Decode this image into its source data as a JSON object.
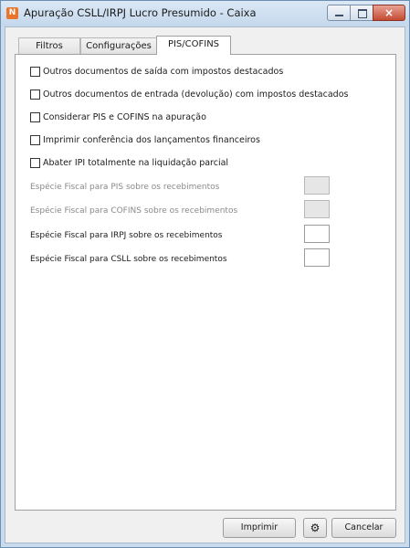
{
  "window": {
    "title": "Apuração CSLL/IRPJ Lucro Presumido - Caixa",
    "app_icon_glyph": "N",
    "close_glyph": "×"
  },
  "tabs": [
    {
      "label": "Filtros"
    },
    {
      "label": "Configurações"
    },
    {
      "label": "PIS/COFINS",
      "active": true
    }
  ],
  "checkboxes": [
    {
      "label": "Outros documentos de saída com impostos destacados",
      "checked": false
    },
    {
      "label": "Outros documentos de entrada (devolução) com impostos destacados",
      "checked": false
    },
    {
      "label": "Considerar PIS e COFINS na apuração",
      "checked": false
    },
    {
      "label": "Imprimir conferência dos lançamentos financeiros",
      "checked": false
    },
    {
      "label": "Abater IPI totalmente na liquidação parcial",
      "checked": false
    }
  ],
  "fields": [
    {
      "label": "Espécie Fiscal para PIS sobre os recebimentos",
      "value": "",
      "disabled": true
    },
    {
      "label": "Espécie Fiscal para COFINS sobre os recebimentos",
      "value": "",
      "disabled": true
    },
    {
      "label": "Espécie Fiscal para IRPJ sobre os recebimentos",
      "value": "",
      "disabled": false
    },
    {
      "label": "Espécie Fiscal para CSLL sobre os recebimentos",
      "value": "",
      "disabled": false
    }
  ],
  "buttons": {
    "print_label": "Imprimir",
    "settings_icon": "gear-icon",
    "cancel_label": "Cancelar"
  },
  "colors": {
    "title_bar": "#c4d8ec",
    "close_button": "#c44a32",
    "disabled_text": "#8a8a8a"
  }
}
